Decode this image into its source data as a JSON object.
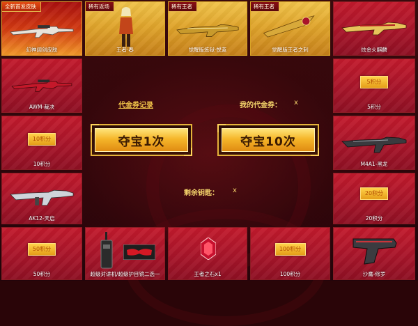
{
  "ribbons": {
    "new_skin": "全新首发皮肤",
    "rare_return": "稀有返场",
    "rare_king1": "稀有王者",
    "rare_king2": "稀有王者"
  },
  "top_row": [
    {
      "caption": "幻神阔剑皮肤"
    },
    {
      "caption": "王者·春"
    },
    {
      "caption": "觉醒版炼狱·悦蓝"
    },
    {
      "caption": "觉醒版王者之刺"
    },
    {
      "caption": "炫金火麒麟"
    }
  ],
  "left_col": [
    {
      "caption": "AWM-裁决"
    },
    {
      "points": "10积分",
      "caption": "10积分"
    },
    {
      "caption": "AK12-天启"
    }
  ],
  "right_col": [
    {
      "points": "5积分",
      "caption": "5积分"
    },
    {
      "caption": "M4A1-黑龙"
    },
    {
      "points": "20积分",
      "caption": "20积分"
    }
  ],
  "bottom_row": [
    {
      "points": "50积分",
      "caption": "50积分"
    },
    {
      "caption": "超级对讲机/超级护目镜二选一"
    },
    {
      "caption": "王者之石x1"
    },
    {
      "points": "100积分",
      "caption": "100积分"
    },
    {
      "caption": "沙鹰-修罗"
    }
  ],
  "center": {
    "voucher_record": "代金券记录",
    "my_voucher_label": "我的代金券：",
    "my_voucher_value": "x",
    "draw_once": "夺宝1次",
    "draw_ten": "夺宝10次",
    "keys_label": "剩余钥匙：",
    "keys_value": "x"
  },
  "colors": {
    "bg": "#2a0508",
    "cell_red": "#b3172b",
    "gold": "#f0c34a",
    "text_gold": "#f3d26a"
  }
}
